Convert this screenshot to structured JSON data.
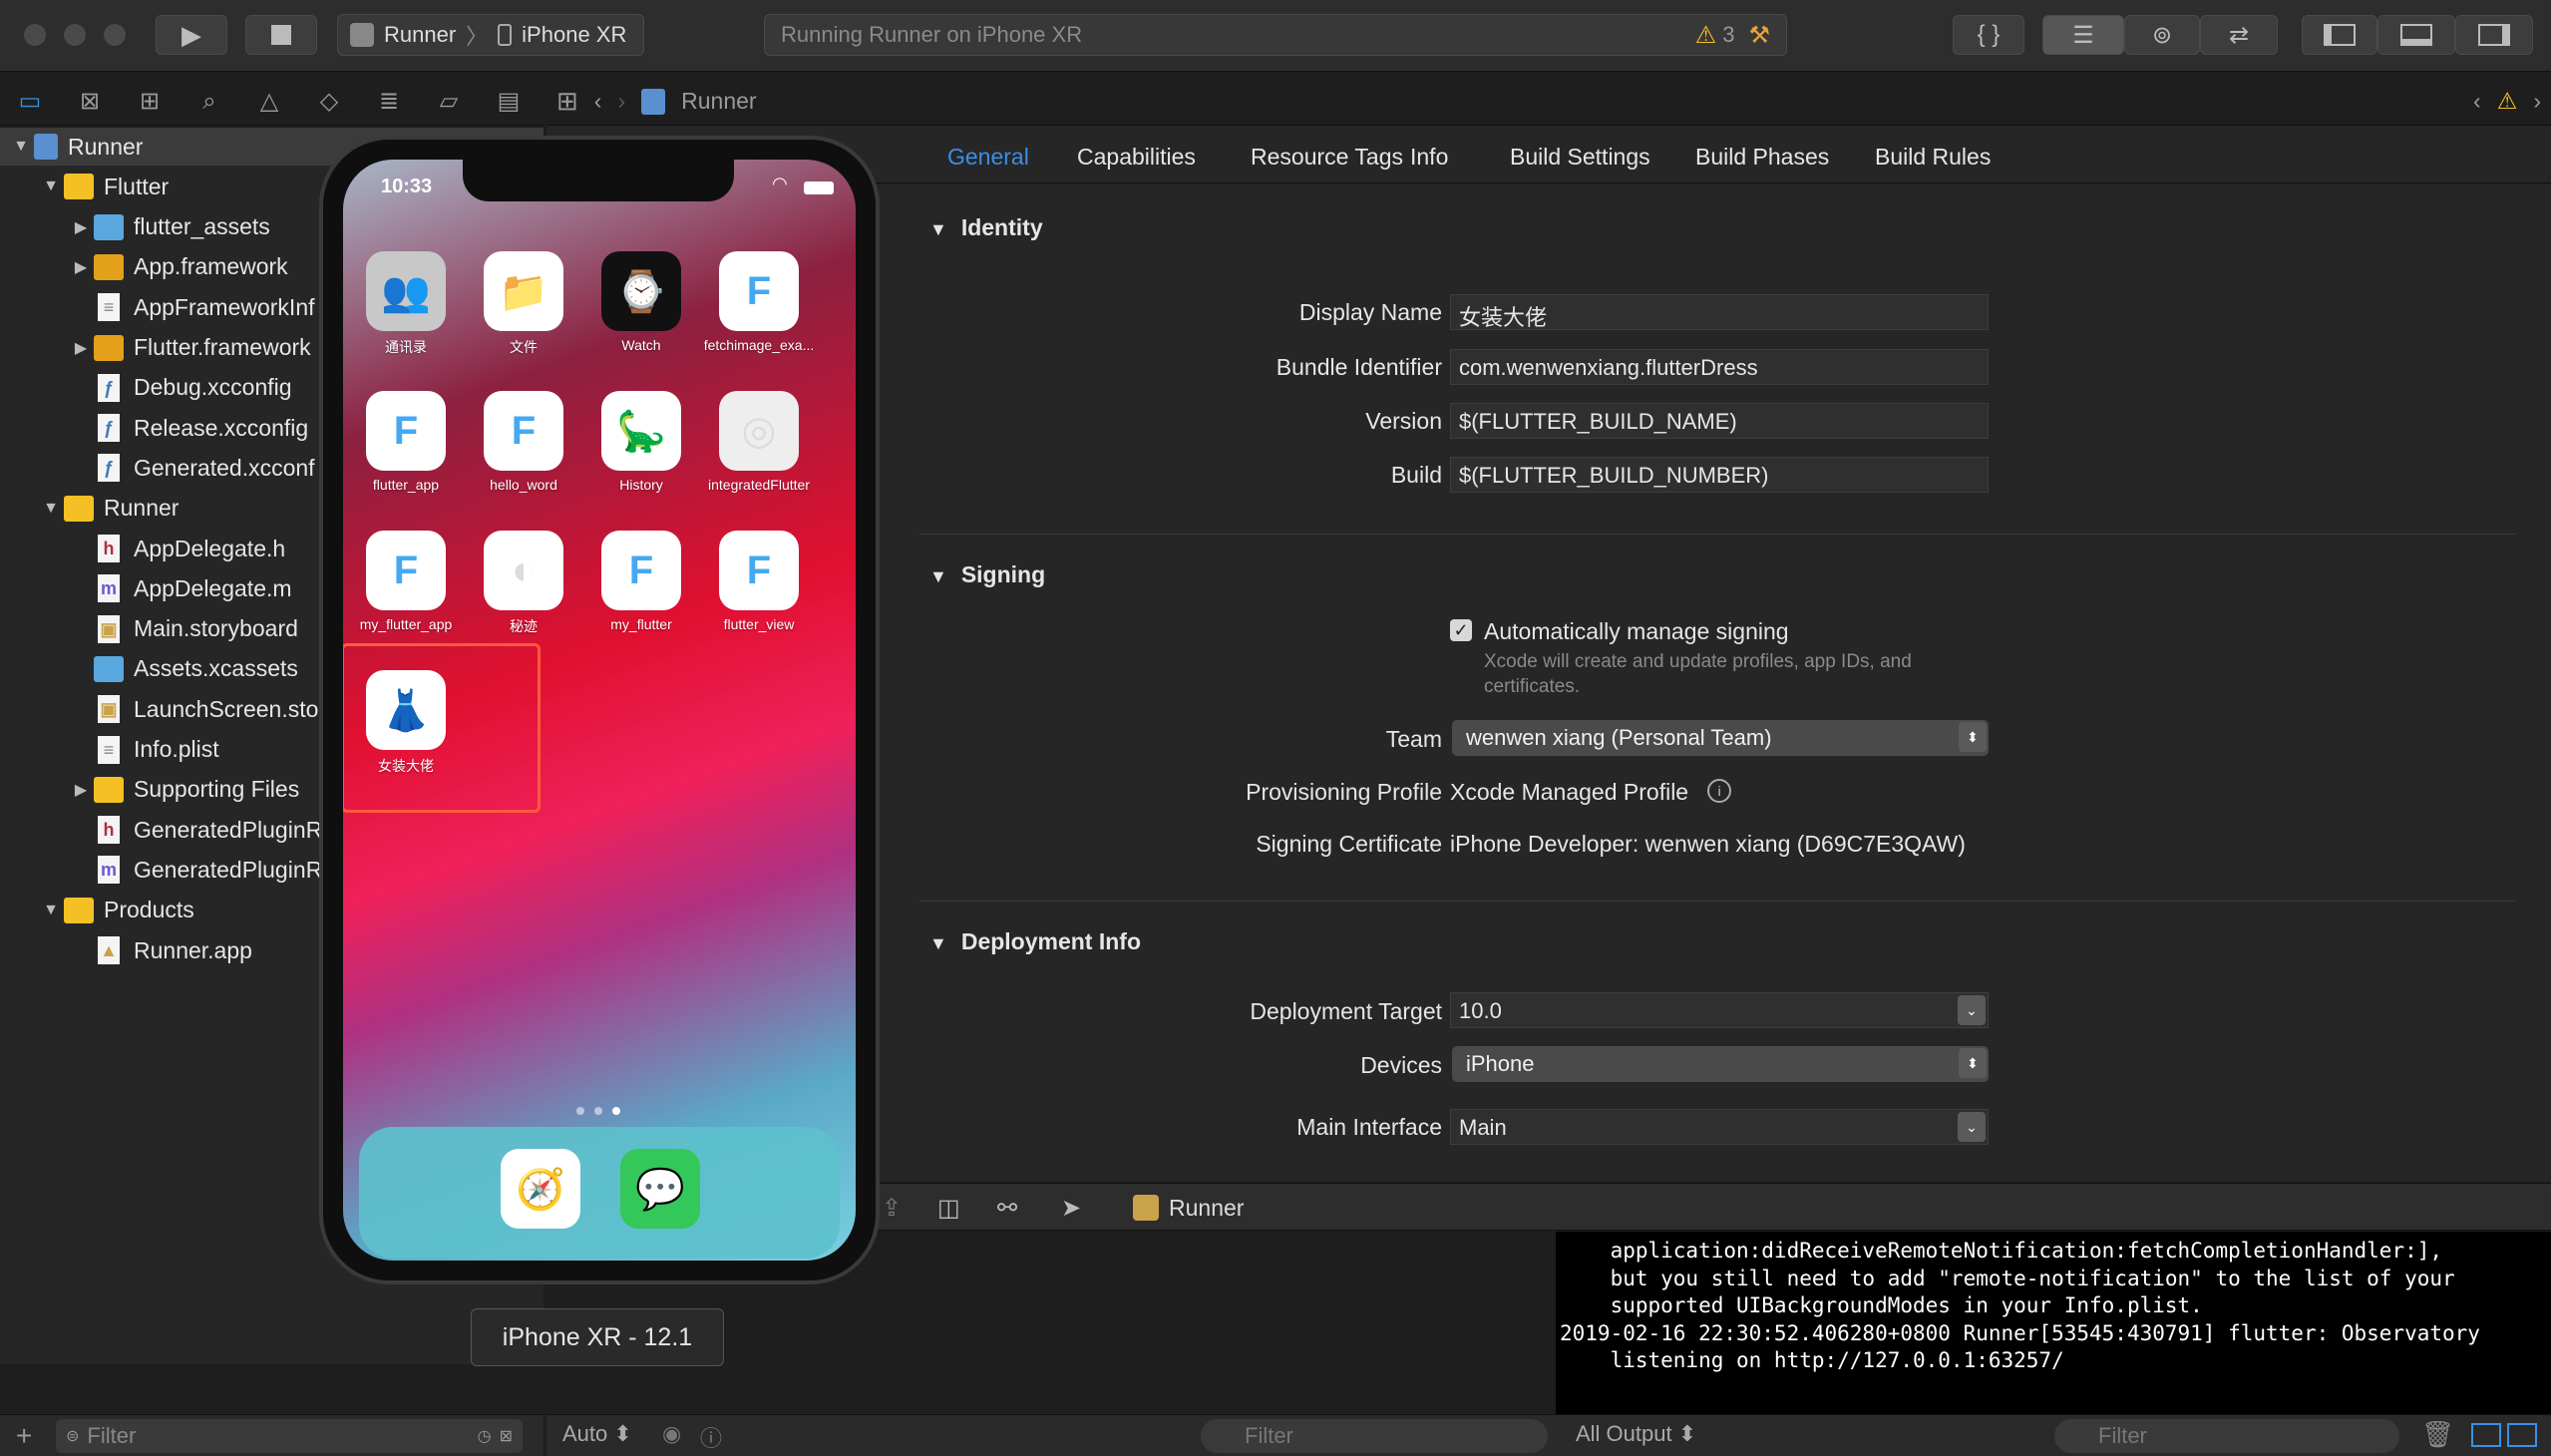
{
  "toolbar": {
    "scheme_project": "Runner",
    "scheme_device": "iPhone XR",
    "activity_text": "Running Runner on iPhone XR",
    "warning_count": "3"
  },
  "jumpbar": {
    "project": "Runner"
  },
  "navigator": {
    "items": [
      {
        "label": "Runner",
        "level": 0,
        "icon": "project-icon",
        "disclosure": "open"
      },
      {
        "label": "Flutter",
        "level": 1,
        "icon": "folder-icon",
        "disclosure": "open"
      },
      {
        "label": "flutter_assets",
        "level": 2,
        "icon": "blue-folder-icon",
        "disclosure": "closed"
      },
      {
        "label": "App.framework",
        "level": 2,
        "icon": "framework-icon",
        "disclosure": "closed"
      },
      {
        "label": "AppFrameworkInf",
        "level": 2,
        "icon": "plist-file-icon",
        "disclosure": "none"
      },
      {
        "label": "Flutter.framework",
        "level": 2,
        "icon": "framework-icon",
        "disclosure": "closed"
      },
      {
        "label": "Debug.xcconfig",
        "level": 2,
        "icon": "config-file-icon",
        "disclosure": "none"
      },
      {
        "label": "Release.xcconfig",
        "level": 2,
        "icon": "config-file-icon",
        "disclosure": "none"
      },
      {
        "label": "Generated.xcconf",
        "level": 2,
        "icon": "config-file-icon",
        "disclosure": "none"
      },
      {
        "label": "Runner",
        "level": 1,
        "icon": "folder-icon",
        "disclosure": "open"
      },
      {
        "label": "AppDelegate.h",
        "level": 2,
        "icon": "header-file-icon",
        "disclosure": "none"
      },
      {
        "label": "AppDelegate.m",
        "level": 2,
        "icon": "objc-file-icon",
        "disclosure": "none"
      },
      {
        "label": "Main.storyboard",
        "level": 2,
        "icon": "storyboard-file-icon",
        "disclosure": "none"
      },
      {
        "label": "Assets.xcassets",
        "level": 2,
        "icon": "assets-folder-icon",
        "disclosure": "none"
      },
      {
        "label": "LaunchScreen.stor",
        "level": 2,
        "icon": "storyboard-file-icon",
        "disclosure": "none"
      },
      {
        "label": "Info.plist",
        "level": 2,
        "icon": "plist-file-icon",
        "disclosure": "none"
      },
      {
        "label": "Supporting Files",
        "level": 2,
        "icon": "folder-icon",
        "disclosure": "closed"
      },
      {
        "label": "GeneratedPluginRe",
        "level": 2,
        "icon": "header-file-icon",
        "disclosure": "none"
      },
      {
        "label": "GeneratedPluginRe",
        "level": 2,
        "icon": "objc-file-icon",
        "disclosure": "none"
      },
      {
        "label": "Products",
        "level": 1,
        "icon": "folder-icon",
        "disclosure": "open"
      },
      {
        "label": "Runner.app",
        "level": 2,
        "icon": "app-product-icon",
        "disclosure": "none"
      }
    ],
    "filter_placeholder": "Filter"
  },
  "tabs": [
    "General",
    "Capabilities",
    "Resource Tags",
    "Info",
    "Build Settings",
    "Build Phases",
    "Build Rules"
  ],
  "identity": {
    "title": "Identity",
    "display_name_label": "Display Name",
    "display_name": "女装大佬",
    "bundle_label": "Bundle Identifier",
    "bundle": "com.wenwenxiang.flutterDress",
    "version_label": "Version",
    "version": "$(FLUTTER_BUILD_NAME)",
    "build_label": "Build",
    "build": "$(FLUTTER_BUILD_NUMBER)"
  },
  "signing": {
    "title": "Signing",
    "auto_label": "Automatically manage signing",
    "auto_note": "Xcode will create and update profiles, app IDs, and certificates.",
    "team_label": "Team",
    "team": "wenwen xiang (Personal Team)",
    "profile_label": "Provisioning Profile",
    "profile": "Xcode Managed Profile",
    "cert_label": "Signing Certificate",
    "cert": "iPhone Developer: wenwen xiang (D69C7E3QAW)"
  },
  "deployment": {
    "title": "Deployment Info",
    "target_label": "Deployment Target",
    "target": "10.0",
    "devices_label": "Devices",
    "devices": "iPhone",
    "main_label": "Main Interface",
    "main": "Main"
  },
  "debugbar": {
    "process": "Runner"
  },
  "variables": {
    "scope": "Auto"
  },
  "console": {
    "lines": [
      "    application:didReceiveRemoteNotification:fetchCompletionHandler:],",
      "    but you still need to add \"remote-notification\" to the list of your",
      "    supported UIBackgroundModes in your Info.plist.",
      "2019-02-16 22:30:52.406280+0800 Runner[53545:430791] flutter: Observatory",
      "    listening on http://127.0.0.1:63257/"
    ],
    "output_select": "All Output",
    "filter_placeholder": "Filter"
  },
  "simulator": {
    "time": "10:33",
    "apps": [
      {
        "name": "通讯录",
        "icon": "contacts-icon",
        "bg": "#c8c8c8",
        "glyph": "👥"
      },
      {
        "name": "文件",
        "icon": "files-icon",
        "bg": "#ffffff",
        "glyph": "📁"
      },
      {
        "name": "Watch",
        "icon": "watch-icon",
        "bg": "#111111",
        "glyph": "⌚"
      },
      {
        "name": "fetchimage_exa...",
        "icon": "flutter-icon",
        "bg": "#ffffff",
        "glyph": "F"
      },
      {
        "name": "flutter_app",
        "icon": "flutter-icon",
        "bg": "#ffffff",
        "glyph": "F"
      },
      {
        "name": "hello_word",
        "icon": "flutter-icon",
        "bg": "#ffffff",
        "glyph": "F"
      },
      {
        "name": "History",
        "icon": "history-icon",
        "bg": "#ffffff",
        "glyph": "🦕"
      },
      {
        "name": "integratedFlutter",
        "icon": "placeholder-app-icon",
        "bg": "#eeeeee",
        "glyph": "◎"
      },
      {
        "name": "my_flutter_app",
        "icon": "flutter-icon",
        "bg": "#ffffff",
        "glyph": "F"
      },
      {
        "name": "秘迹",
        "icon": "mystery-icon",
        "bg": "#ffffff",
        "glyph": "◐"
      },
      {
        "name": "my_flutter",
        "icon": "flutter-icon",
        "bg": "#ffffff",
        "glyph": "F"
      },
      {
        "name": "flutter_view",
        "icon": "flutter-icon",
        "bg": "#ffffff",
        "glyph": "F"
      },
      {
        "name": "女装大佬",
        "icon": "dress-icon",
        "bg": "#ffffff",
        "glyph": "👗"
      }
    ],
    "dock": [
      {
        "icon": "safari-icon",
        "glyph": "🧭",
        "bg": "#ffffff"
      },
      {
        "icon": "messages-icon",
        "glyph": "💬",
        "bg": "#34c759"
      }
    ],
    "label": "iPhone XR - 12.1"
  },
  "colors": {
    "accent": "#3a8fe8",
    "highlight_box": "#ff5a3c",
    "warning": "#f5c023"
  }
}
